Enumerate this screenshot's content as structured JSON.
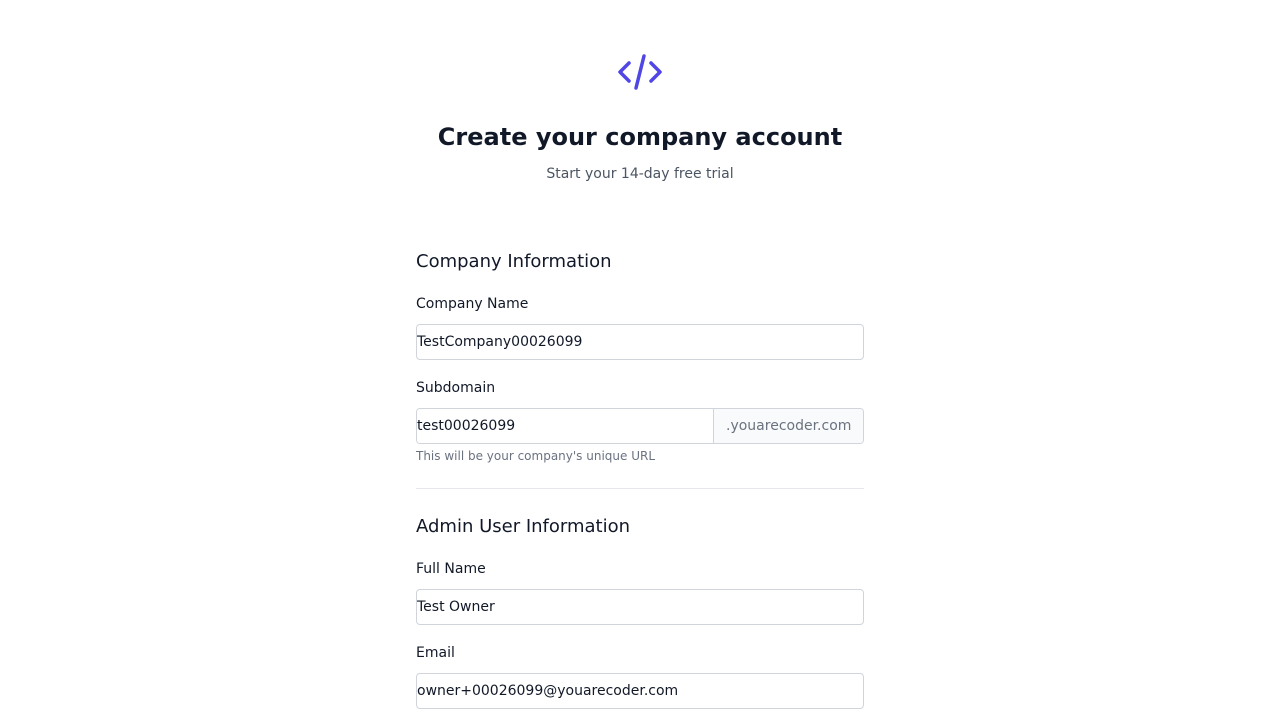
{
  "colors": {
    "accent": "#4f46e5",
    "heading": "#111827",
    "muted": "#6b7280",
    "border": "#d1d5db"
  },
  "header": {
    "logo_icon": "code-icon",
    "title": "Create your company account",
    "subtitle": "Start your 14-day free trial"
  },
  "company_section": {
    "title": "Company Information",
    "company_name": {
      "label": "Company Name",
      "value": "TestCompany00026099"
    },
    "subdomain": {
      "label": "Subdomain",
      "value": "test00026099",
      "suffix": ".youarecoder.com",
      "help": "This will be your company's unique URL"
    }
  },
  "admin_section": {
    "title": "Admin User Information",
    "full_name": {
      "label": "Full Name",
      "value": "Test Owner"
    },
    "email": {
      "label": "Email",
      "value": "owner+00026099@youarecoder.com"
    }
  }
}
